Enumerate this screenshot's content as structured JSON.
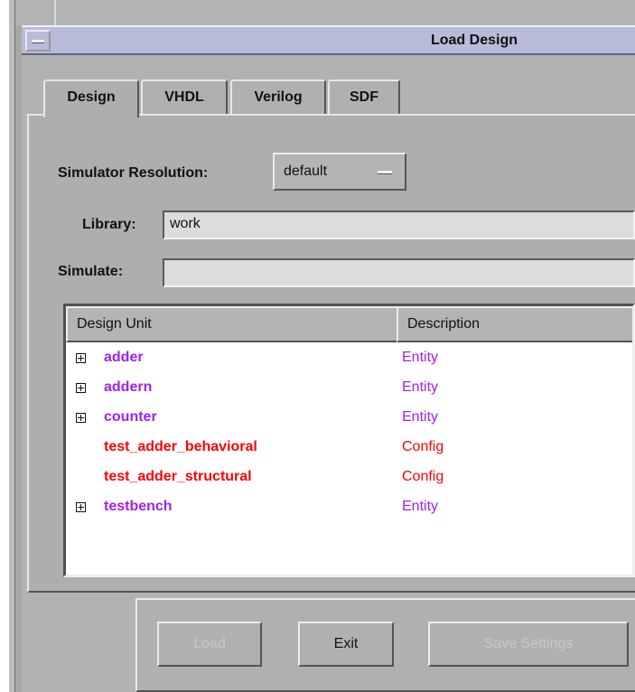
{
  "window": {
    "title": "Load Design"
  },
  "tabs": [
    {
      "label": "Design",
      "active": true
    },
    {
      "label": "VHDL",
      "active": false
    },
    {
      "label": "Verilog",
      "active": false
    },
    {
      "label": "SDF",
      "active": false
    }
  ],
  "form": {
    "resolution_label": "Simulator Resolution:",
    "resolution_value": "default",
    "library_label": "Library:",
    "library_value": "work",
    "simulate_label": "Simulate:",
    "simulate_value": ""
  },
  "design_units": {
    "columns": [
      "Design Unit",
      "Description"
    ],
    "rows": [
      {
        "name": "adder",
        "description": "Entity",
        "expandable": true,
        "color": "#a020f0"
      },
      {
        "name": "addern",
        "description": "Entity",
        "expandable": true,
        "color": "#a020f0"
      },
      {
        "name": "counter",
        "description": "Entity",
        "expandable": true,
        "color": "#a020f0"
      },
      {
        "name": "test_adder_behavioral",
        "description": "Config",
        "expandable": false,
        "color": "#ff0000"
      },
      {
        "name": "test_adder_structural",
        "description": "Config",
        "expandable": false,
        "color": "#ff0000"
      },
      {
        "name": "testbench",
        "description": "Entity",
        "expandable": true,
        "color": "#a020f0"
      }
    ]
  },
  "buttons": {
    "load": "Load",
    "exit": "Exit",
    "save_settings": "Save Settings"
  },
  "colors": {
    "entity": "#a020f0",
    "config": "#ff0000",
    "title_bar": "#b8bcd8"
  }
}
